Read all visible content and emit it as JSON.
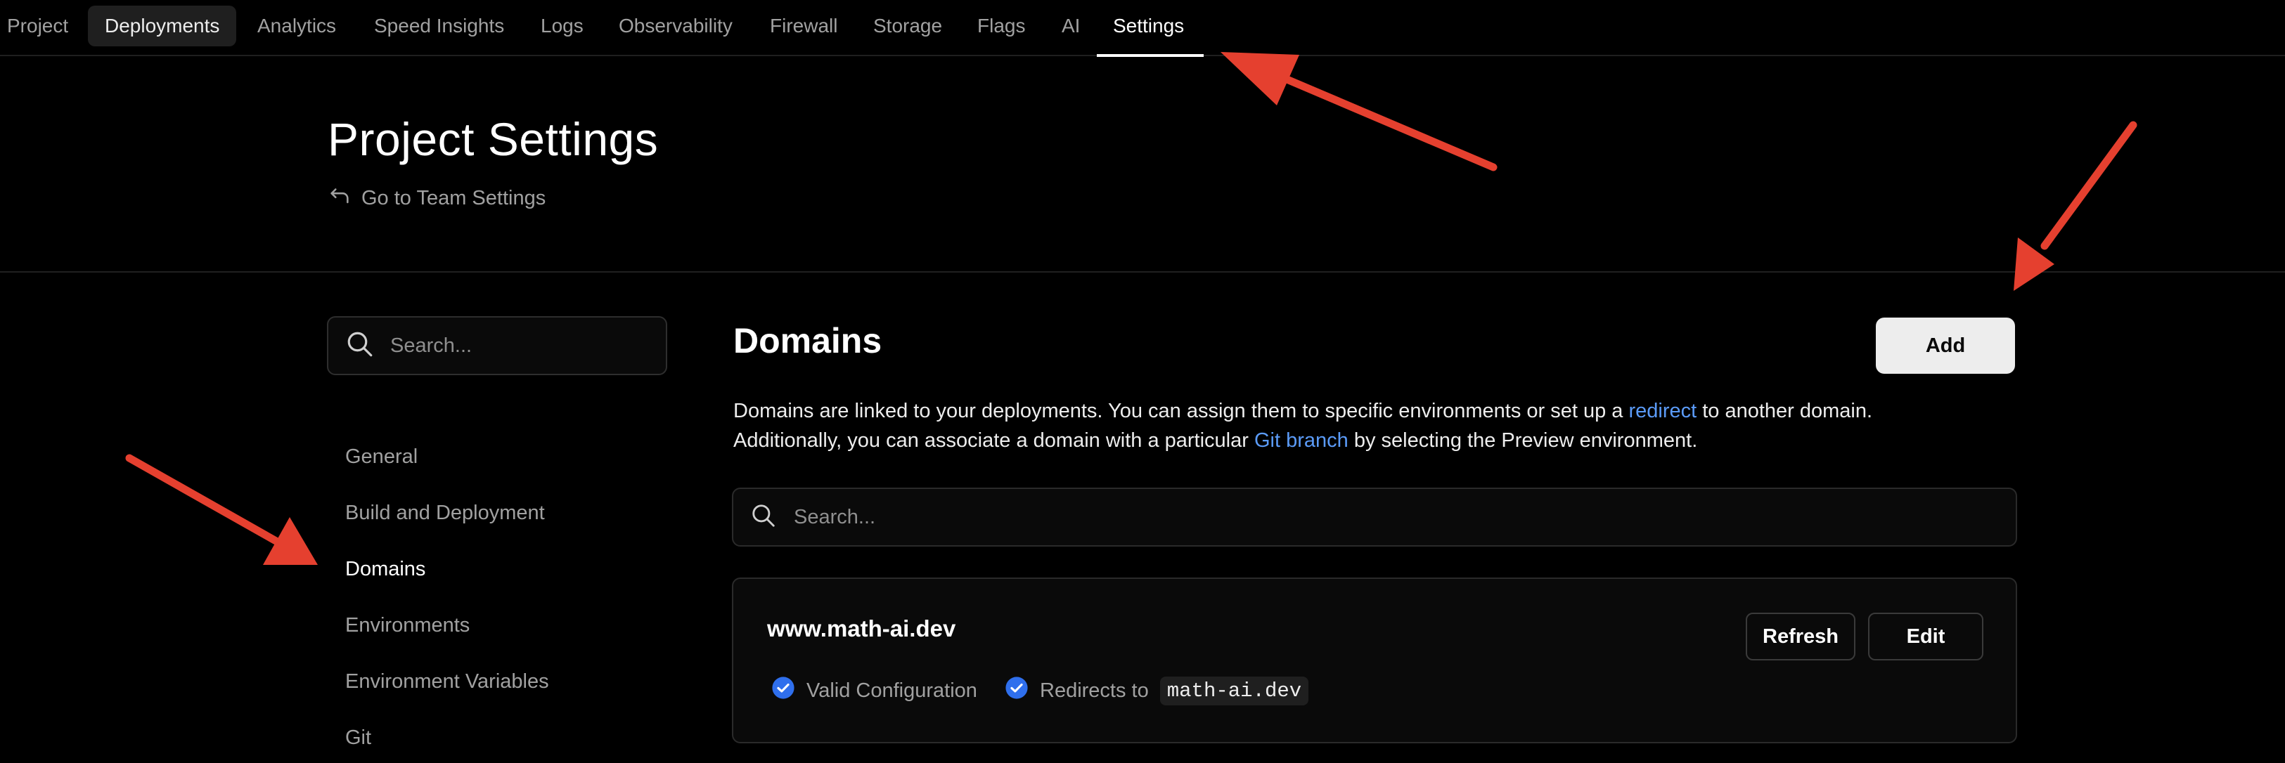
{
  "nav": {
    "tabs": [
      {
        "label": "Project"
      },
      {
        "label": "Deployments"
      },
      {
        "label": "Analytics"
      },
      {
        "label": "Speed Insights"
      },
      {
        "label": "Logs"
      },
      {
        "label": "Observability"
      },
      {
        "label": "Firewall"
      },
      {
        "label": "Storage"
      },
      {
        "label": "Flags"
      },
      {
        "label": "AI"
      },
      {
        "label": "Settings"
      }
    ],
    "active": "Settings",
    "hovered": "Deployments"
  },
  "header": {
    "title": "Project Settings",
    "team_link": "Go to Team Settings"
  },
  "sidebar": {
    "search_placeholder": "Search...",
    "items": [
      {
        "label": "General"
      },
      {
        "label": "Build and Deployment"
      },
      {
        "label": "Domains"
      },
      {
        "label": "Environments"
      },
      {
        "label": "Environment Variables"
      },
      {
        "label": "Git"
      }
    ],
    "active": "Domains"
  },
  "main": {
    "title": "Domains",
    "add_label": "Add",
    "description": {
      "line1_pre": "Domains are linked to your deployments. You can assign them to specific environments or set up a ",
      "line1_link": "redirect",
      "line1_post": " to another domain.",
      "line2_pre": "Additionally, you can associate a domain with a particular ",
      "line2_link": "Git branch",
      "line2_post": " by selecting the Preview environment."
    },
    "search_placeholder": "Search...",
    "domains": [
      {
        "name": "www.math-ai.dev",
        "refresh_label": "Refresh",
        "edit_label": "Edit",
        "status_valid": "Valid Configuration",
        "redirect_label": "Redirects to",
        "redirect_target": "math-ai.dev"
      }
    ]
  },
  "colors": {
    "background": "#000000",
    "link": "#5b9bf8",
    "check": "#2f6fed",
    "annotation_arrow": "#e5402f"
  },
  "icons": [
    "search-icon",
    "return-arrow-icon",
    "check-circle-icon"
  ]
}
